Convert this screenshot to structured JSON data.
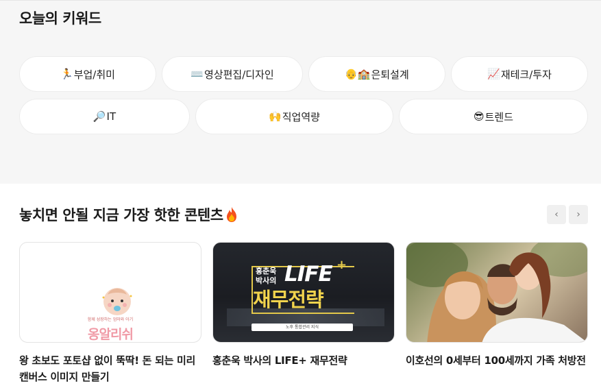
{
  "keywords": {
    "title": "오늘의 키워드",
    "chips": [
      {
        "emoji": "🏃",
        "label": "부업/취미"
      },
      {
        "emoji": "⌨️",
        "label": "영상편집/디자인"
      },
      {
        "emoji": "👴🏫",
        "label": "은퇴설계"
      },
      {
        "emoji": "📈",
        "label": "재테크/투자"
      },
      {
        "emoji": "🔎",
        "label": "IT"
      },
      {
        "emoji": "🙌",
        "label": "직업역량"
      },
      {
        "emoji": "😎",
        "label": "트렌드"
      }
    ]
  },
  "section": {
    "title": "놓치면 안될 지금 가장 핫한 콘텐츠",
    "prev": "‹",
    "next": "›"
  },
  "cards": [
    {
      "title": "왕 초보도 포토샵 없이 뚝딱! 돈 되는 미리캔버스 이미지 만들기",
      "thumb_sub": "함께 성장하는 엄마와 아기",
      "thumb_brand": "옹알리쉬"
    },
    {
      "title": "홍춘욱 박사의 LIFE+ 재무전략",
      "thumb_name_1": "홍춘욱",
      "thumb_name_2": "박사의",
      "thumb_life": "LIFE",
      "thumb_plus": "+",
      "thumb_main": "재무전략",
      "thumb_bar": "노후 통합관리 지식"
    },
    {
      "title": "이호선의 0세부터 100세까지 가족 처방전"
    }
  ]
}
